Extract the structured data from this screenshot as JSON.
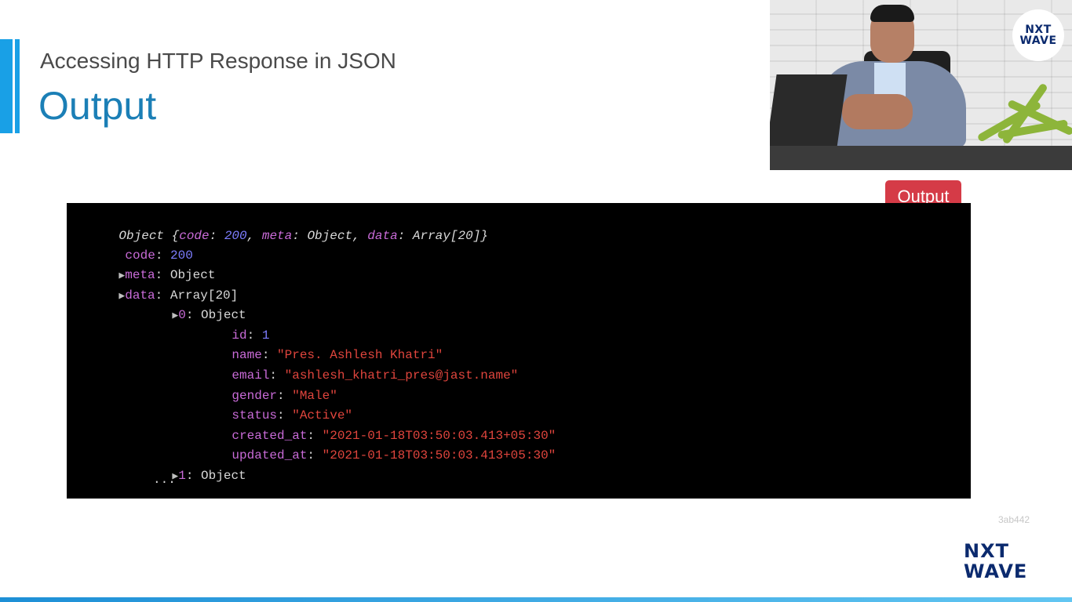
{
  "slide": {
    "subtitle": "Accessing HTTP Response in JSON",
    "title": "Output",
    "badge": "Output",
    "hash": "3ab442",
    "brand_line1": "NXT",
    "brand_line2": "WAVE",
    "video_logo_line1": "NXT",
    "video_logo_line2": "WAVE"
  },
  "console": {
    "line1": {
      "obj": "Object {",
      "k1": "code",
      "c1": ": ",
      "v1": "200",
      "c2": ", ",
      "k2": "meta",
      "c3": ": Object, ",
      "k3": "data",
      "c4": ": Array[20]}"
    },
    "line2": {
      "k": "code",
      "c": ": ",
      "v": "200"
    },
    "line3": {
      "tri": "▶",
      "k": "meta",
      "c": ": Object"
    },
    "line4": {
      "tri": "▶",
      "k": "data",
      "c": ": Array[20]"
    },
    "line5": {
      "tri": "▶",
      "k": "0",
      "c": ": Object"
    },
    "fields": [
      {
        "k": "id",
        "c": ": ",
        "v": "1"
      },
      {
        "k": "name",
        "c": ": ",
        "v": "\"Pres. Ashlesh Khatri\""
      },
      {
        "k": "email",
        "c": ": ",
        "v": "\"ashlesh_khatri_pres@jast.name\""
      },
      {
        "k": "gender",
        "c": ": ",
        "v": "\"Male\""
      },
      {
        "k": "status",
        "c": ": ",
        "v": "\"Active\""
      },
      {
        "k": "created_at",
        "c": ": ",
        "v": "\"2021-01-18T03:50:03.413+05:30\""
      },
      {
        "k": "updated_at",
        "c": ": ",
        "v": "\"2021-01-18T03:50:03.413+05:30\""
      }
    ],
    "line13": {
      "tri": "▶",
      "k": "1",
      "c": ": Object"
    },
    "ellipsis": "..."
  }
}
